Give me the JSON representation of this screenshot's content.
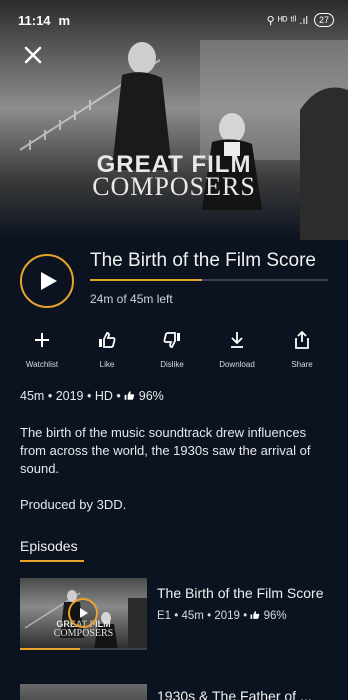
{
  "status_bar": {
    "time": "11:14",
    "app_indicator": "m",
    "system_icons": "⚲ ᴴᴰ ᵗˡˡ .ıl",
    "battery": "27"
  },
  "hero": {
    "title_line1": "GREAT FILM",
    "title_line2": "COMPOSERS"
  },
  "now_playing": {
    "title": "The Birth of the Film Score",
    "time_left": "24m of 45m left",
    "progress_fraction": 0.47
  },
  "actions": [
    {
      "name": "watchlist",
      "label": "Watchlist",
      "icon": "plus-icon"
    },
    {
      "name": "like",
      "label": "Like",
      "icon": "thumbs-up-icon"
    },
    {
      "name": "dislike",
      "label": "Dislike",
      "icon": "thumbs-down-icon"
    },
    {
      "name": "download",
      "label": "Download",
      "icon": "download-icon"
    },
    {
      "name": "share",
      "label": "Share",
      "icon": "share-icon"
    }
  ],
  "meta": {
    "duration": "45m",
    "year": "2019",
    "quality": "HD",
    "rating": "96%",
    "separator": "•"
  },
  "description": "The birth of the music soundtrack drew influences from across the world, the 1930s saw the arrival of sound.",
  "producer": "Produced by 3DD.",
  "episodes_tab": "Episodes",
  "episodes": [
    {
      "title": "The Birth of the Film Score",
      "episode": "E1",
      "duration": "45m",
      "year": "2019",
      "rating": "96%",
      "thumb_line1": "GREAT FILM",
      "thumb_line2": "COMPOSERS",
      "progress_fraction": 0.47
    },
    {
      "title": "1930s & The Father of ..."
    }
  ],
  "colors": {
    "background": "#0b1320",
    "accent": "#e8a32b",
    "text": "#f0f0f0"
  }
}
